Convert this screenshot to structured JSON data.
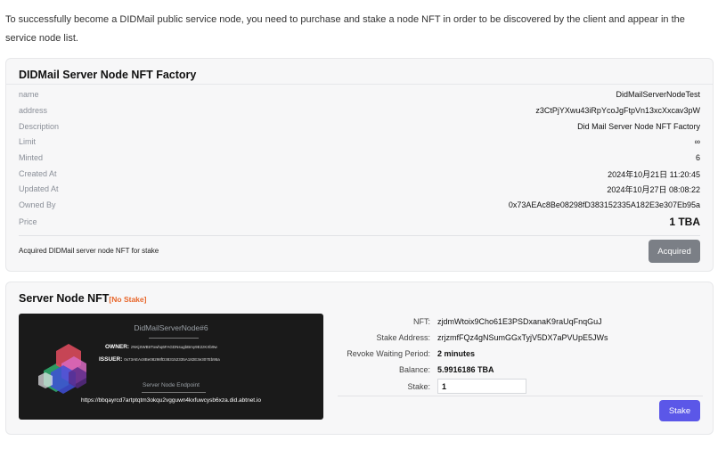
{
  "intro_text": "To successfully become a DIDMail public service node, you need to purchase and stake a node NFT in order to be discovered by the client and appear in the service node list.",
  "factory": {
    "title": "DIDMail Server Node NFT Factory",
    "rows": [
      {
        "label": "name",
        "value": "DidMailServerNodeTest"
      },
      {
        "label": "address",
        "value": "z3CtPjYXwu43iRpYcoJgFtpVn13xcXxcav3pW"
      },
      {
        "label": "Description",
        "value": "Did Mail Server Node NFT Factory"
      },
      {
        "label": "Limit",
        "value": "∞"
      },
      {
        "label": "Minted",
        "value": "6"
      },
      {
        "label": "Created At",
        "value": "2024年10月21日 11:20:45"
      },
      {
        "label": "Updated At",
        "value": "2024年10月27日 08:08:22"
      },
      {
        "label": "Owned By",
        "value": "0x73AEAc8Be08298fD383152335A182E3e307Eb95a"
      },
      {
        "label": "Price",
        "value": "1 TBA"
      }
    ],
    "acquired_note": "Acquired DIDMail server node NFT for stake",
    "acquired_button": "Acquired"
  },
  "server_node": {
    "title": "Server Node NFT",
    "status_badge": "[No Stake]",
    "card": {
      "name": "DidMailServerNode#6",
      "owner_label": "OWNER:",
      "owner_value": "zNKjSWBtrTowhq6FAGDNsugbBmy9E2zKXb9w",
      "issuer_label": "ISSUER:",
      "issuer_value": "0x73AEAc8Be08298fD383152335A182E3e307Eb95a",
      "endpoint_label": "Server Node Endpoint",
      "endpoint_value": "https://bbqayrcd7artptqtm3okqu2vgguwn4kxfuwcysb6xza.did.abtnet.io"
    },
    "info": {
      "nft_label": "NFT:",
      "nft_value": "zjdmWtoix9Cho61E3PSDxanaK9raUqFnqGuJ",
      "stake_address_label": "Stake Address:",
      "stake_address_value": "zrjzmfFQz4gNSumGGxTyjV5DX7aPVUpE5JWs",
      "revoke_label": "Revoke Waiting Period:",
      "revoke_value": "2 minutes",
      "balance_label": "Balance:",
      "balance_value": "5.9916186 TBA",
      "stake_label": "Stake:",
      "stake_value": "1"
    },
    "stake_button": "Stake"
  },
  "colors": {
    "accent_button": "#5b57e8",
    "disabled_button": "#7b7f86",
    "no_stake_badge": "#e8662a"
  }
}
